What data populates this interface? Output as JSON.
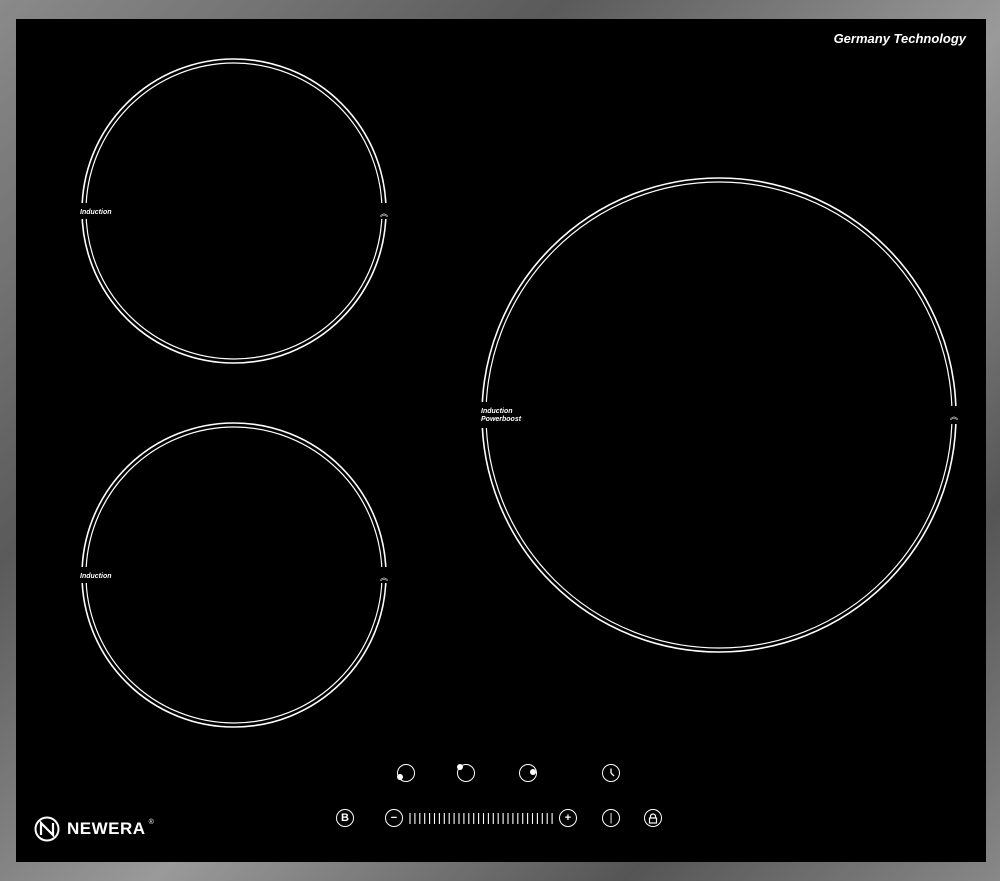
{
  "brand_tag": "Germany Technology",
  "logo": {
    "name": "NEWERA",
    "mark": "®"
  },
  "zones": [
    {
      "id": "front-left-zone",
      "label_lines": [
        "Induction"
      ]
    },
    {
      "id": "rear-left-zone",
      "label_lines": [
        "Induction"
      ]
    },
    {
      "id": "right-zone",
      "label_lines": [
        "Induction",
        "Powerboost"
      ]
    }
  ],
  "controls": {
    "boost_label": "B",
    "minus_label": "−",
    "plus_label": "+",
    "power_label": "|",
    "lock_icon": "lock-icon",
    "timer_icon": "clock-icon"
  },
  "colors": {
    "glass": "#000000",
    "frame": "#7a7a7a",
    "print": "#ffffff"
  }
}
